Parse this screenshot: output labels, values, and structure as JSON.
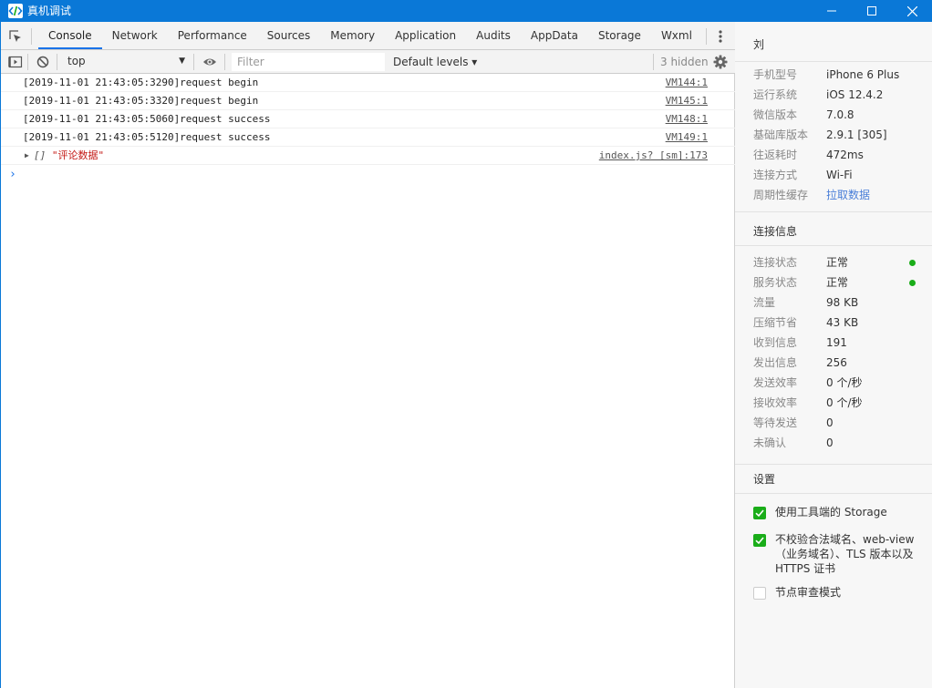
{
  "window": {
    "title": "真机调试",
    "icon": "code-brackets-icon"
  },
  "devtools": {
    "tabs": [
      "Console",
      "Network",
      "Performance",
      "Sources",
      "Memory",
      "Application",
      "Audits",
      "AppData",
      "Storage",
      "Wxml"
    ],
    "active_tab": "Console",
    "toolbar": {
      "context": "top",
      "filter_placeholder": "Filter",
      "levels": "Default levels ▾",
      "hidden_count": "3 hidden"
    },
    "console_messages": [
      {
        "text": "[2019-11-01 21:43:05:3290]request begin",
        "source": "VM144:1"
      },
      {
        "text": "[2019-11-01 21:43:05:3320]request begin",
        "source": "VM145:1"
      },
      {
        "text": "[2019-11-01 21:43:05:5060]request success",
        "source": "VM148:1"
      },
      {
        "text": "[2019-11-01 21:43:05:5120]request success",
        "source": "VM149:1"
      }
    ],
    "object_message": {
      "bracket": "[]",
      "string": "\"评论数据\"",
      "source": "index.js? [sm]:173"
    },
    "prompt": "›"
  },
  "side": {
    "user": "刘",
    "device_info": [
      {
        "label": "手机型号",
        "value": "iPhone 6 Plus"
      },
      {
        "label": "运行系统",
        "value": "iOS 12.4.2"
      },
      {
        "label": "微信版本",
        "value": "7.0.8"
      },
      {
        "label": "基础库版本",
        "value": "2.9.1 [305]"
      },
      {
        "label": "往返耗时",
        "value": "472ms"
      },
      {
        "label": "连接方式",
        "value": "Wi-Fi"
      },
      {
        "label": "周期性缓存",
        "value": "拉取数据",
        "link": true
      }
    ],
    "conn_title": "连接信息",
    "conn_info": [
      {
        "label": "连接状态",
        "value": "正常",
        "status_dot": true
      },
      {
        "label": "服务状态",
        "value": "正常",
        "status_dot": true
      },
      {
        "label": "流量",
        "value": "98 KB"
      },
      {
        "label": "压缩节省",
        "value": "43 KB"
      },
      {
        "label": "收到信息",
        "value": "191"
      },
      {
        "label": "发出信息",
        "value": "256"
      },
      {
        "label": "发送效率",
        "value": "0 个/秒"
      },
      {
        "label": "接收效率",
        "value": "0 个/秒"
      },
      {
        "label": "等待发送",
        "value": "0"
      },
      {
        "label": "未确认",
        "value": "0"
      }
    ],
    "settings_title": "设置",
    "settings": [
      {
        "label": "使用工具端的 Storage",
        "checked": true
      },
      {
        "label": "不校验合法域名、web-view（业务域名）、TLS 版本以及 HTTPS 证书",
        "checked": true
      },
      {
        "label": "节点审查模式",
        "checked": false
      }
    ]
  },
  "colors": {
    "titlebar": "#0a78d7",
    "accent": "#1a73e8",
    "status_green": "#1aad19",
    "link": "#4a7fd8"
  }
}
